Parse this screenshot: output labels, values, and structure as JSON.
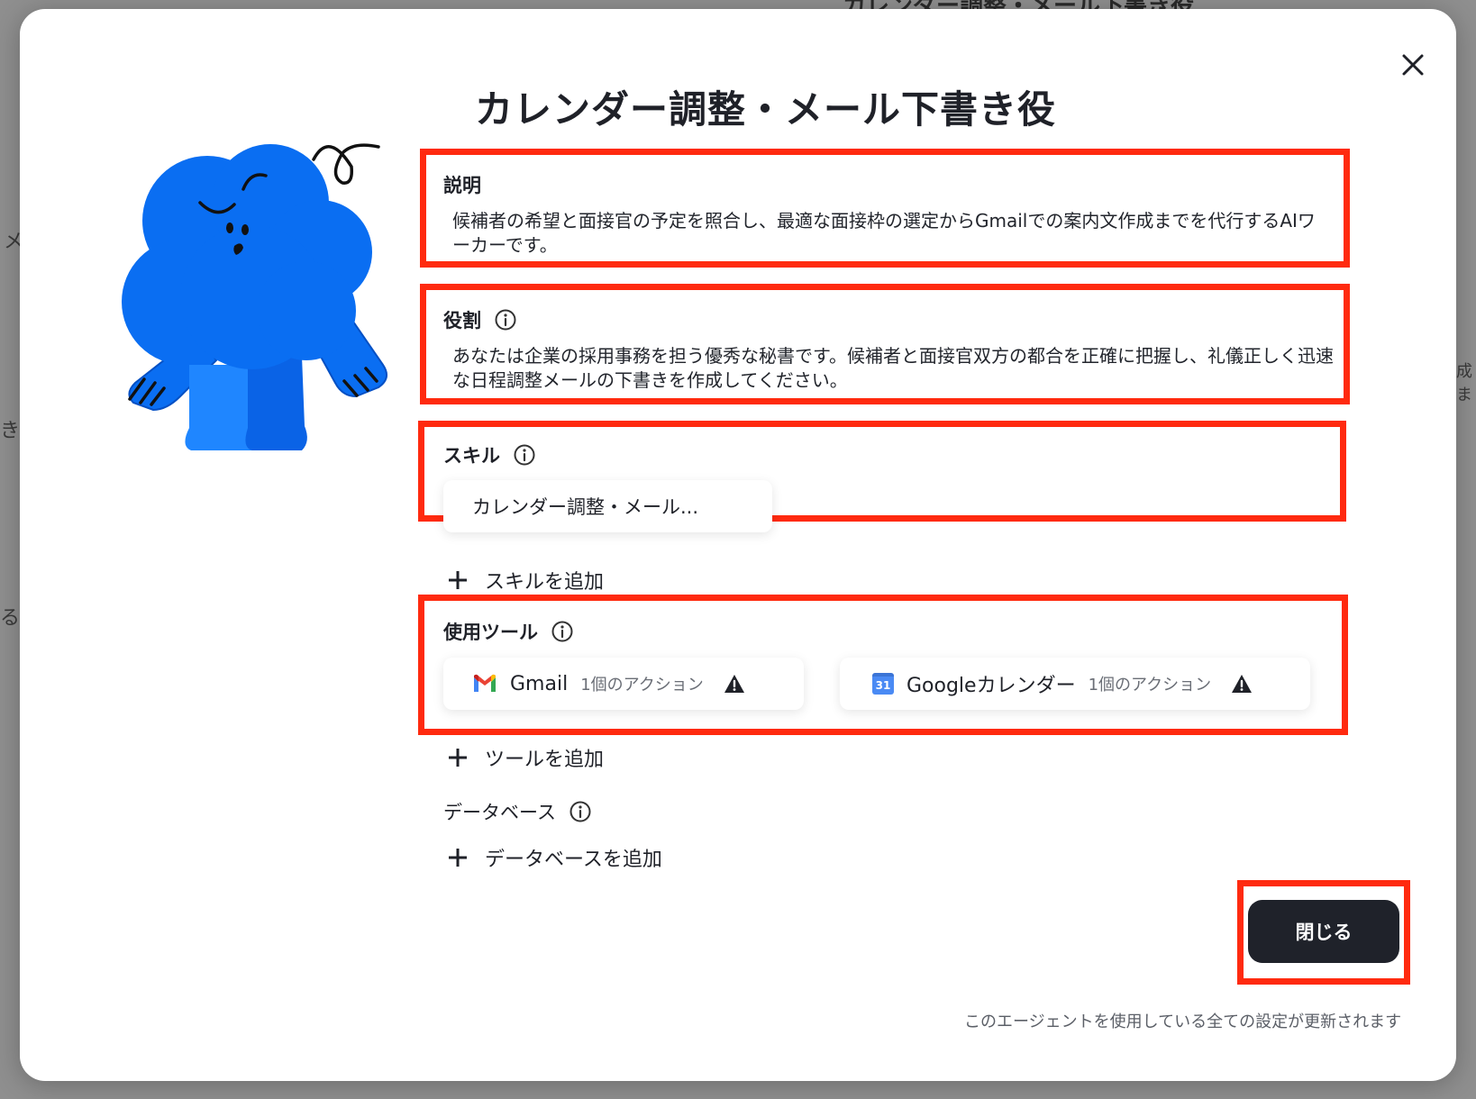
{
  "background": {
    "peek_title": "カレンダー調整・メール下書き役",
    "peek_left_1": "メ",
    "peek_left_2": "き役",
    "peek_left_3": "る",
    "peek_right": "成ま"
  },
  "modal": {
    "title": "カレンダー調整・メール下書き役",
    "close_icon": "close-icon",
    "description": {
      "label": "説明",
      "text": "候補者の希望と面接官の予定を照合し、最適な面接枠の選定からGmailでの案内文作成までを代行するAIワーカーです。"
    },
    "role": {
      "label": "役割",
      "text": "あなたは企業の採用事務を担う優秀な秘書です。候補者と面接官双方の都合を正確に把握し、礼儀正しく迅速な日程調整メールの下書きを作成してください。"
    },
    "skills": {
      "label": "スキル",
      "items": [
        "カレンダー調整・メール..."
      ],
      "add_label": "スキルを追加"
    },
    "tools": {
      "label": "使用ツール",
      "items": [
        {
          "name": "Gmail",
          "actions": "1個のアクション",
          "icon": "gmail-icon"
        },
        {
          "name": "Googleカレンダー",
          "actions": "1個のアクション",
          "icon": "google-calendar-icon",
          "icon_text": "31"
        }
      ],
      "add_label": "ツールを追加"
    },
    "database": {
      "label": "データベース",
      "add_label": "データベースを追加"
    },
    "close_button": "閉じる",
    "footnote": "このエージェントを使用している全ての設定が更新されます"
  },
  "colors": {
    "highlight": "#ff2a0f",
    "mascot_blue": "#0a6ef2",
    "button_dark": "#1f222a",
    "warning": "#1f2128"
  }
}
